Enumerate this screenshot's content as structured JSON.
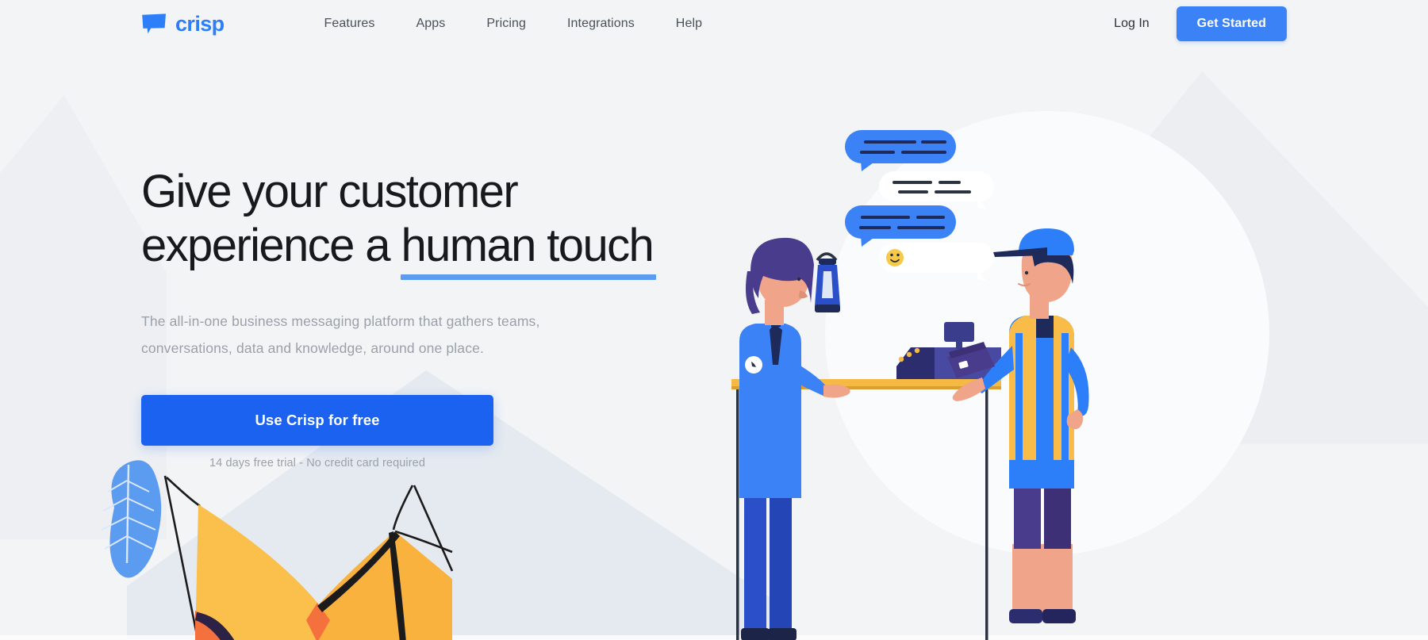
{
  "brand": {
    "name": "crisp",
    "logo_icon": "speech-bubble-icon",
    "accent_blue": "#2d7ff9",
    "button_blue": "#3b82f6",
    "cta_blue": "#1a62ef",
    "underline_blue": "#5b9bf0",
    "page_background": "#f2f4f6"
  },
  "header": {
    "nav_items": [
      {
        "label": "Features"
      },
      {
        "label": "Apps"
      },
      {
        "label": "Pricing"
      },
      {
        "label": "Integrations"
      },
      {
        "label": "Help"
      }
    ],
    "login_label": "Log In",
    "get_started_label": "Get Started"
  },
  "hero": {
    "headline_line1": "Give your customer",
    "headline_line2_prefix": "experience a ",
    "headline_line2_highlight": "human touch",
    "subhead_line1": "The all-in-one business messaging platform that gathers teams,",
    "subhead_line2": "conversations, data and knowledge, around one place.",
    "cta_label": "Use Crisp for free",
    "cta_note": "14 days free trial - No credit card required"
  },
  "illustration": {
    "title": "customer-support-checkout-illustration",
    "chat_bubbles": [
      {
        "type": "outgoing",
        "color": "#3b82f6",
        "content": "text-lines"
      },
      {
        "type": "incoming",
        "color": "#ffffff",
        "content": "text-lines"
      },
      {
        "type": "outgoing",
        "color": "#3b82f6",
        "content": "text-lines"
      },
      {
        "type": "incoming",
        "color": "#ffffff",
        "content": "smiley-emoji"
      }
    ],
    "characters": [
      {
        "name": "support-agent-woman",
        "hair": "#4a3c8c",
        "shirt": "#3b82f6",
        "tie": "#1e2a5a",
        "pants": "#2b4fc8"
      },
      {
        "name": "delivery-man",
        "cap": "#2d7ff9",
        "vest": "#f9bc48",
        "shirt": "#2d7ff9",
        "shorts": "#4a3c8c"
      }
    ],
    "props": [
      {
        "name": "lantern",
        "color": "#1e2a5a"
      },
      {
        "name": "credit-card",
        "color": "#4a3c8c"
      },
      {
        "name": "cash-register",
        "color": "#3b3d8f"
      },
      {
        "name": "counter-table",
        "color": "#f5b944"
      },
      {
        "name": "camping-tent",
        "color": "#fbbf4c"
      },
      {
        "name": "fern-leaf",
        "color": "#5b9bf0"
      }
    ]
  }
}
